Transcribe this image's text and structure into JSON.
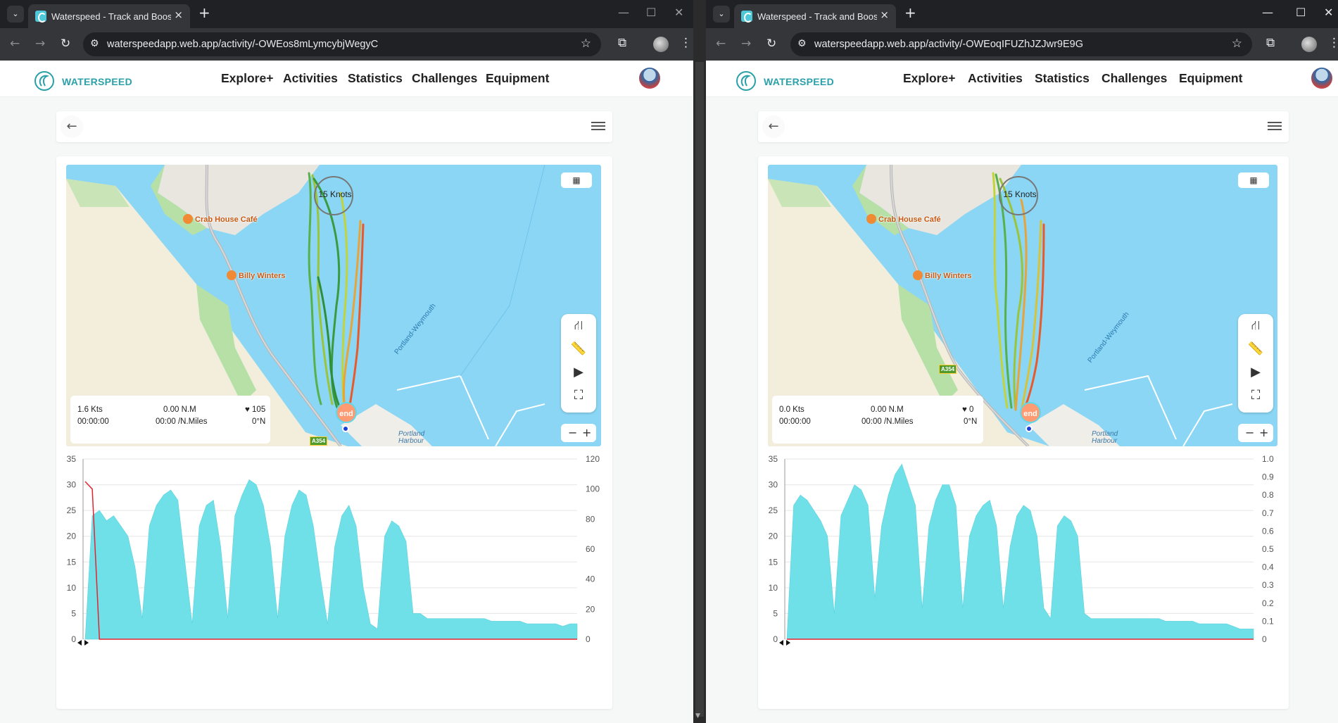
{
  "colors": {
    "accent": "#2aa0a8",
    "speed_fill": "#6fdfe8",
    "heart_line": "#e5232f",
    "water": "#8ad6f4",
    "land": "#f3eedc",
    "park": "#b7e0a7"
  },
  "windows": [
    {
      "tab_title": "Waterspeed - Track and Boost y",
      "url": "waterspeedapp.web.app/activity/-OWEos8mLymcybjWegyC",
      "brand": "WATERSPEED",
      "nav": [
        "Explore+",
        "Activities",
        "Statistics",
        "Challenges",
        "Equipment"
      ],
      "map": {
        "knots_label": "15 Knots",
        "pois": [
          "Crab House Café",
          "Billy Winters"
        ],
        "water_label": "Portland-Weymouth",
        "harbour_label": [
          "Portland",
          "Harbour"
        ],
        "road_label": "A354",
        "end_label": "end",
        "info": {
          "speed": "1.6 Kts",
          "time": "00:00:00",
          "distance": "0.00 N.M",
          "pace": "00:00 /N.Miles",
          "heart": "105",
          "heading": "0°N"
        },
        "icons": [
          "route-icon",
          "ruler-icon",
          "play-icon",
          "fullscreen-icon"
        ],
        "zoom": {
          "minus": "−",
          "plus": "+"
        }
      },
      "chart_data": {
        "type": "area",
        "title": "",
        "xlabel": "",
        "ylabel": "",
        "ylim": [
          0,
          35
        ],
        "y_ticks": [
          "0",
          "5",
          "10",
          "15",
          "20",
          "25",
          "30",
          "35"
        ],
        "y2lim": [
          0,
          120
        ],
        "y2_ticks": [
          "0",
          "20",
          "40",
          "60",
          "80",
          "100",
          "120"
        ],
        "series": [
          {
            "axis": "left",
            "values": [
              0,
              24,
              25,
              23,
              24,
              22,
              20,
              14,
              4,
              22,
              26,
              28,
              29,
              27,
              15,
              3,
              22,
              26,
              27,
              18,
              4,
              24,
              28,
              31,
              30,
              26,
              18,
              4,
              20,
              26,
              29,
              28,
              22,
              12,
              3,
              18,
              24,
              26,
              22,
              10,
              3,
              2,
              20,
              23,
              22,
              19,
              5,
              5,
              4,
              4,
              4,
              4,
              4,
              4,
              4,
              4,
              4,
              3.5,
              3.5,
              3.5,
              3.5,
              3.5,
              3,
              3,
              3,
              3,
              3,
              2.5,
              3,
              3
            ]
          },
          {
            "axis": "right",
            "values": [
              105,
              100,
              0,
              0,
              0,
              0,
              0,
              0,
              0,
              0,
              0,
              0,
              0,
              0,
              0,
              0,
              0,
              0,
              0,
              0,
              0,
              0,
              0,
              0,
              0,
              0,
              0,
              0,
              0,
              0,
              0,
              0,
              0,
              0,
              0,
              0,
              0,
              0,
              0,
              0,
              0,
              0,
              0,
              0,
              0,
              0,
              0,
              0,
              0,
              0,
              0,
              0,
              0,
              0,
              0,
              0,
              0,
              0,
              0,
              0,
              0,
              0,
              0,
              0,
              0,
              0,
              0,
              0,
              0,
              0
            ]
          }
        ]
      }
    },
    {
      "tab_title": "Waterspeed - Track and Boost y",
      "url": "waterspeedapp.web.app/activity/-OWEoqIFUZhJZJwr9E9G",
      "brand": "WATERSPEED",
      "nav": [
        "Explore+",
        "Activities",
        "Statistics",
        "Challenges",
        "Equipment"
      ],
      "map": {
        "knots_label": "15 Knots",
        "pois": [
          "Crab House Café",
          "Billy Winters"
        ],
        "water_label": "Portland-Weymouth",
        "harbour_label": [
          "Portland",
          "Harbour"
        ],
        "road_label": "A354",
        "end_label": "end",
        "info": {
          "speed": "0.0 Kts",
          "time": "00:00:00",
          "distance": "0.00 N.M",
          "pace": "00:00 /N.Miles",
          "heart": "0",
          "heading": "0°N"
        },
        "icons": [
          "route-icon",
          "ruler-icon",
          "play-icon",
          "fullscreen-icon"
        ],
        "zoom": {
          "minus": "−",
          "plus": "+"
        }
      },
      "chart_data": {
        "type": "area",
        "title": "",
        "xlabel": "",
        "ylabel": "",
        "ylim": [
          0,
          35
        ],
        "y_ticks": [
          "0",
          "5",
          "10",
          "15",
          "20",
          "25",
          "30",
          "35"
        ],
        "y2lim": [
          0,
          1.0
        ],
        "y2_ticks": [
          "0",
          "0.1",
          "0.2",
          "0.3",
          "0.4",
          "0.5",
          "0.6",
          "0.7",
          "0.8",
          "0.9",
          "1.0"
        ],
        "series": [
          {
            "axis": "left",
            "values": [
              0,
              26,
              28,
              27,
              25,
              23,
              20,
              5,
              24,
              27,
              30,
              29,
              26,
              8,
              22,
              28,
              32,
              34,
              30,
              26,
              6,
              22,
              27,
              30,
              30,
              26,
              6,
              20,
              24,
              26,
              27,
              22,
              6,
              18,
              24,
              26,
              25,
              20,
              6,
              4,
              22,
              24,
              23,
              20,
              5,
              4,
              4,
              4,
              4,
              4,
              4,
              4,
              4,
              4,
              4,
              4,
              3.5,
              3.5,
              3.5,
              3.5,
              3.5,
              3,
              3,
              3,
              3,
              3,
              2.5,
              2,
              2,
              2
            ]
          },
          {
            "axis": "right",
            "values": [
              0,
              0,
              0,
              0,
              0,
              0,
              0,
              0,
              0,
              0,
              0,
              0,
              0,
              0,
              0,
              0,
              0,
              0,
              0,
              0,
              0,
              0,
              0,
              0,
              0,
              0,
              0,
              0,
              0,
              0,
              0,
              0,
              0,
              0,
              0,
              0,
              0,
              0,
              0,
              0,
              0,
              0,
              0,
              0,
              0,
              0,
              0,
              0,
              0,
              0,
              0,
              0,
              0,
              0,
              0,
              0,
              0,
              0,
              0,
              0,
              0,
              0,
              0,
              0,
              0,
              0,
              0,
              0,
              0,
              0
            ]
          }
        ]
      }
    }
  ]
}
